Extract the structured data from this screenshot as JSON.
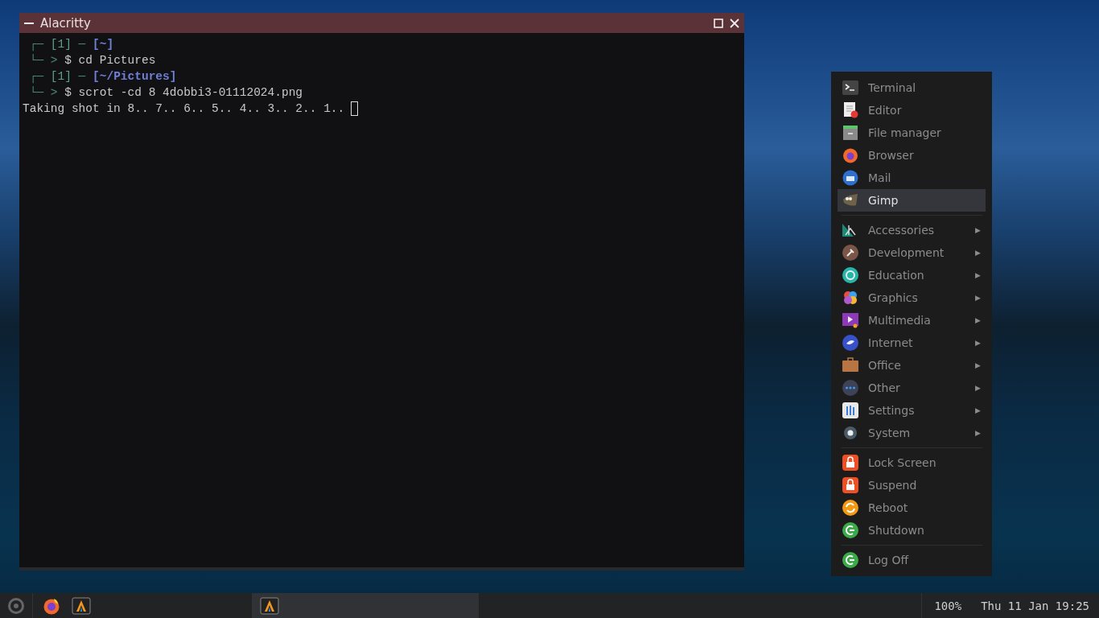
{
  "terminal": {
    "title": "Alacritty",
    "lines": [
      {
        "kind": "prompt",
        "lead": "┌─",
        "count": "[1]",
        "sep": "─",
        "path": "[~]"
      },
      {
        "kind": "command",
        "lead": "└─ >",
        "text": "$ cd Pictures"
      },
      {
        "kind": "prompt",
        "lead": "┌─",
        "count": "[1]",
        "sep": "─",
        "path": "[~/Pictures]"
      },
      {
        "kind": "command",
        "lead": "└─ >",
        "text": "$ scrot -cd 8 4dobbi3-01112024.png"
      },
      {
        "kind": "output",
        "text": "Taking shot in 8.. 7.. 6.. 5.. 4.. 3.. 2.. 1.."
      }
    ]
  },
  "menu": {
    "groups": [
      [
        {
          "label": "Terminal",
          "selected": false
        },
        {
          "label": "Editor",
          "selected": false
        },
        {
          "label": "File manager",
          "selected": false
        },
        {
          "label": "Browser",
          "selected": false
        },
        {
          "label": "Mail",
          "selected": false
        },
        {
          "label": "Gimp",
          "selected": true
        }
      ],
      [
        {
          "label": "Accessories",
          "selected": false,
          "arrow": "▶"
        },
        {
          "label": "Development",
          "selected": false,
          "arrow": "▶"
        },
        {
          "label": "Education",
          "selected": false,
          "arrow": "▶"
        },
        {
          "label": "Graphics",
          "selected": false,
          "arrow": "▶"
        },
        {
          "label": "Multimedia",
          "selected": false,
          "arrow": "▶"
        },
        {
          "label": "Internet",
          "selected": false,
          "arrow": "▶"
        },
        {
          "label": "Office",
          "selected": false,
          "arrow": "▶"
        },
        {
          "label": "Other",
          "selected": false,
          "arrow": "▶"
        },
        {
          "label": "Settings",
          "selected": false,
          "arrow": "▶"
        },
        {
          "label": "System",
          "selected": false,
          "arrow": "▶"
        }
      ],
      [
        {
          "label": "Lock Screen",
          "selected": false
        },
        {
          "label": "Suspend",
          "selected": false
        },
        {
          "label": "Reboot",
          "selected": false
        },
        {
          "label": "Shutdown",
          "selected": false
        }
      ],
      [
        {
          "label": "Log Off",
          "selected": false
        }
      ]
    ]
  },
  "taskbar": {
    "tasks": [
      {
        "selected": true
      }
    ],
    "battery": "100%",
    "clock": "Thu 11 Jan 19:25"
  }
}
